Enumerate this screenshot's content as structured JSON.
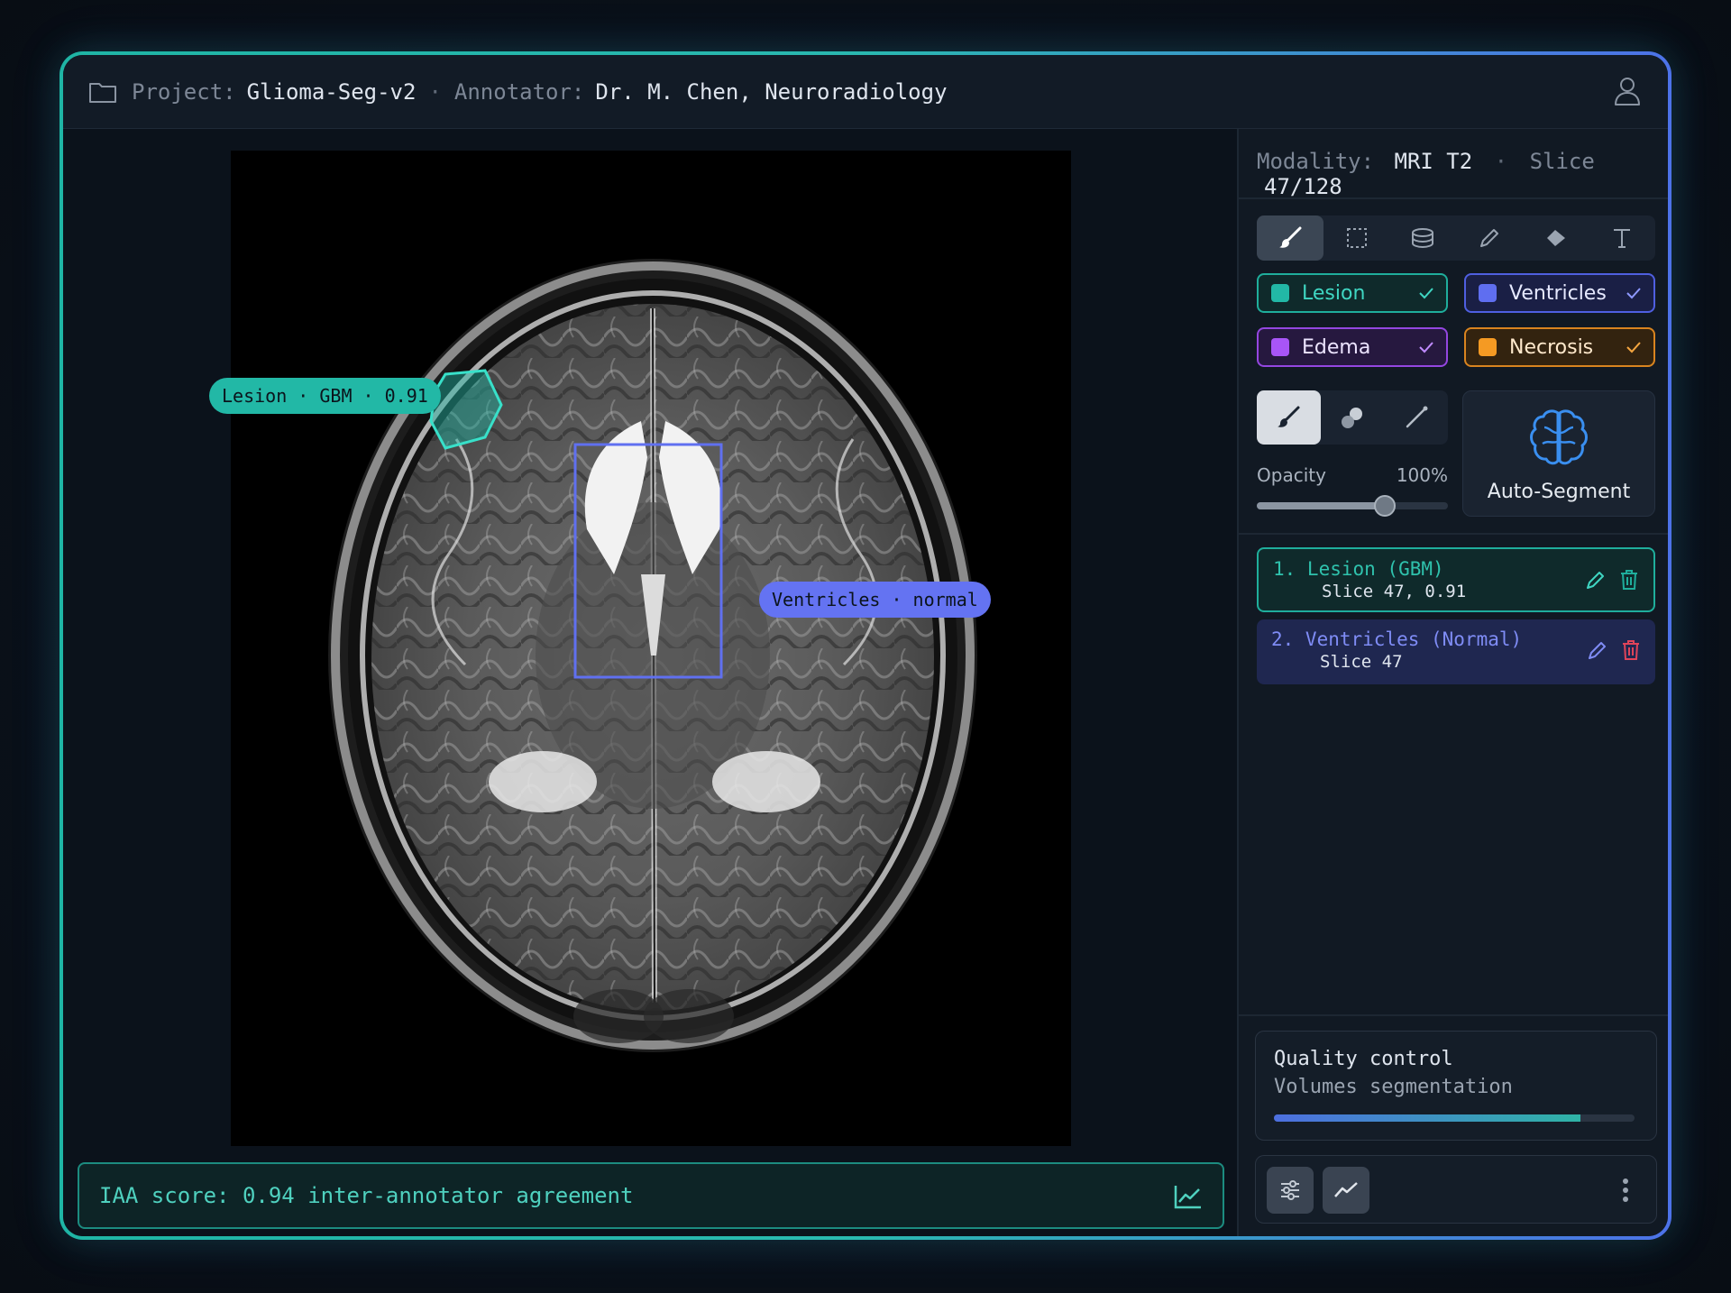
{
  "header": {
    "project_label": "Project:",
    "project_value": "Glioma-Seg-v2",
    "separator": "·",
    "annotator_label": "Annotator:",
    "annotator_value": "Dr. M. Chen, Neuroradiology",
    "icons": {
      "folder": "folder-icon",
      "user": "user-icon"
    }
  },
  "viewer": {
    "overlays": [
      {
        "label": "Lesion · GBM · 0.91",
        "color": "#22b8a6"
      },
      {
        "label": "Ventricles · normal",
        "color": "#5f6ef0"
      }
    ],
    "iaa_text": "IAA score: 0.94 inter-annotator agreement"
  },
  "panel": {
    "modality_label": "Modality:",
    "modality_value": "MRI T2",
    "slice_label": "Slice",
    "slice_value": "47/128",
    "tools": [
      "brush-icon",
      "rect-select-icon",
      "volume-icon",
      "pencil-icon",
      "fill-icon",
      "text-icon"
    ],
    "classes": [
      {
        "label": "Lesion",
        "color": "#22b8a6",
        "checked": true
      },
      {
        "label": "Ventricles",
        "color": "#5f6ef0",
        "checked": true
      },
      {
        "label": "Edema",
        "color": "#a855f7",
        "checked": true
      },
      {
        "label": "Necrosis",
        "color": "#f59a23",
        "checked": true
      }
    ],
    "opacity_label": "Opacity",
    "opacity_value": "100%",
    "opacity_slider_level": 0.67,
    "autoseg_label": "Auto-Segment",
    "annotations": [
      {
        "title": "1. Lesion (GBM)",
        "sub": "Slice 47, 0.91",
        "color": "#2fc2ad"
      },
      {
        "title": "2. Ventricles (Normal)",
        "sub": "Slice 47",
        "color": "#7f8cf5"
      }
    ],
    "qc_title": "Quality control",
    "qc_sub": "Volumes segmentation",
    "qc_progress": 0.85
  }
}
